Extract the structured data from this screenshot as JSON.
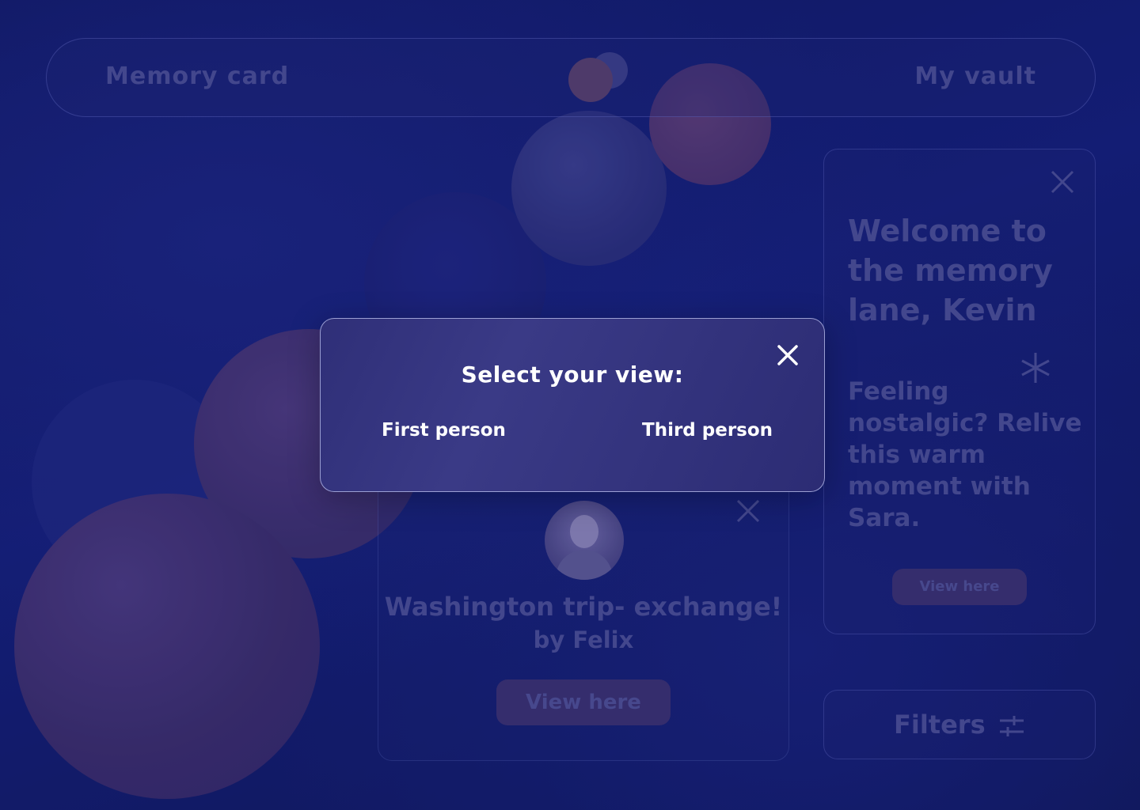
{
  "nav": {
    "brand": "Memory card",
    "vault_link": "My vault"
  },
  "welcome_card": {
    "title": "Welcome to the memory lane, Kevin",
    "body": "Feeling nostalgic? Relive this warm moment with Sara.",
    "button_label": "View here"
  },
  "memory_card": {
    "title": "Washington trip- exchange!",
    "byline": "by Felix",
    "button_label": "View here"
  },
  "filters": {
    "label": "Filters",
    "icon": "sliders-icon"
  },
  "modal": {
    "title": "Select your view:",
    "options": [
      {
        "label": "First person"
      },
      {
        "label": "Third person"
      }
    ],
    "close_icon": "close-icon"
  },
  "colors": {
    "background": "#0f1858",
    "muted_text": "#4a4f96",
    "button_fill": "#3a3172",
    "modal_fill": "#33337e",
    "modal_text": "#ffffff"
  }
}
